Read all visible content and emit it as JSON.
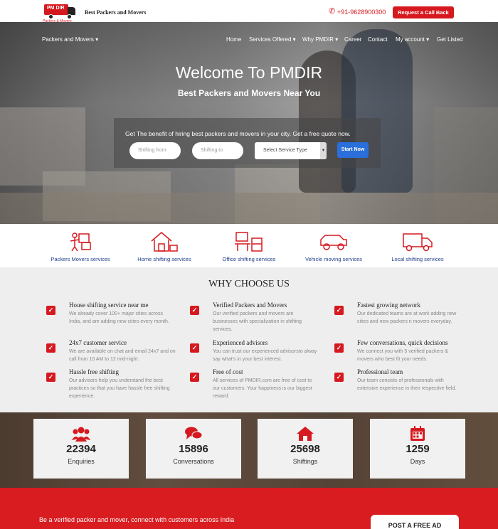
{
  "header": {
    "logo_text": "PM DIR",
    "logo_sub": "Packers & Movers",
    "site_name": "Best Packers and Movers",
    "phone": "+91-9628900300",
    "callback_label": "Request a Call Back"
  },
  "nav": {
    "items": [
      {
        "label": "Packers and Movers ▾"
      },
      {
        "label": "Home"
      },
      {
        "label": "Services Offered ▾"
      },
      {
        "label": "Why PMDIR ▾"
      },
      {
        "label": "Career"
      },
      {
        "label": "Contact"
      },
      {
        "label": "My account ▾"
      },
      {
        "label": "Get Listed"
      }
    ]
  },
  "hero": {
    "title": "Welcome To PMDIR",
    "subtitle": "Best Packers and Movers Near You",
    "form_text": "Get The benefit of hiring best packers and movers in your city. Get a free quote now.",
    "from_placeholder": "Shifting from",
    "to_placeholder": "Shifting to",
    "select_value": "Select Service Type",
    "start_label": "Start Now"
  },
  "services": [
    {
      "label": "Packers Movers services",
      "icon": "movers-icon"
    },
    {
      "label": "Home shifting services",
      "icon": "home-shifting-icon"
    },
    {
      "label": "Office shifting services",
      "icon": "office-shifting-icon"
    },
    {
      "label": "Vehicle moving services",
      "icon": "vehicle-icon"
    },
    {
      "label": "Local shifting services",
      "icon": "truck-icon"
    }
  ],
  "why": {
    "title": "WHY CHOOSE US",
    "features": [
      {
        "title": "House shifting service near me",
        "desc": "We already cover 100+ major cities across India, and are adding new cities every month."
      },
      {
        "title": "Verified Packers and Movers",
        "desc": "Our verified packers and movers are businesses with specialization in shifting services."
      },
      {
        "title": "Fastest growing network",
        "desc": "Our dedicated teams are at work adding new cities and new packers n movers everyday."
      },
      {
        "title": "24x7 customer service",
        "desc": "We are available on chat and email 24x7 and on call from 10 AM to 12 mid-night."
      },
      {
        "title": "Experienced advisors",
        "desc": "You can trust our experienced advisorsto alway say what's in your best interest."
      },
      {
        "title": "Few conversations, quick decisions",
        "desc": "We connect you with 5 verified packers & movers who best fit your needs."
      },
      {
        "title": "Hassle free shifting",
        "desc": "Our advisors help you understand the best practices so that you have hassle free shifting experience."
      },
      {
        "title": "Free of cost",
        "desc": "All services of PMDIR.com are free of cost to our customers. Your happiness is our biggest reward."
      },
      {
        "title": "Professional team",
        "desc": "Our team consists of professionals with extensive experience in their respective field."
      }
    ]
  },
  "stats": [
    {
      "value": "22394",
      "label": "Enquiries",
      "icon": "users-icon"
    },
    {
      "value": "15896",
      "label": "Conversations",
      "icon": "chat-icon"
    },
    {
      "value": "25698",
      "label": "Shiftings",
      "icon": "home-icon"
    },
    {
      "value": "1259",
      "label": "Days",
      "icon": "calendar-icon"
    }
  ],
  "cta": {
    "text": "Be a verified packer and mover, connect with customers across India",
    "button_label": "POST A FREE AD"
  },
  "colors": {
    "brand_red": "#d6191f",
    "link_blue": "#1f3f88",
    "button_blue": "#2a6fdb"
  }
}
